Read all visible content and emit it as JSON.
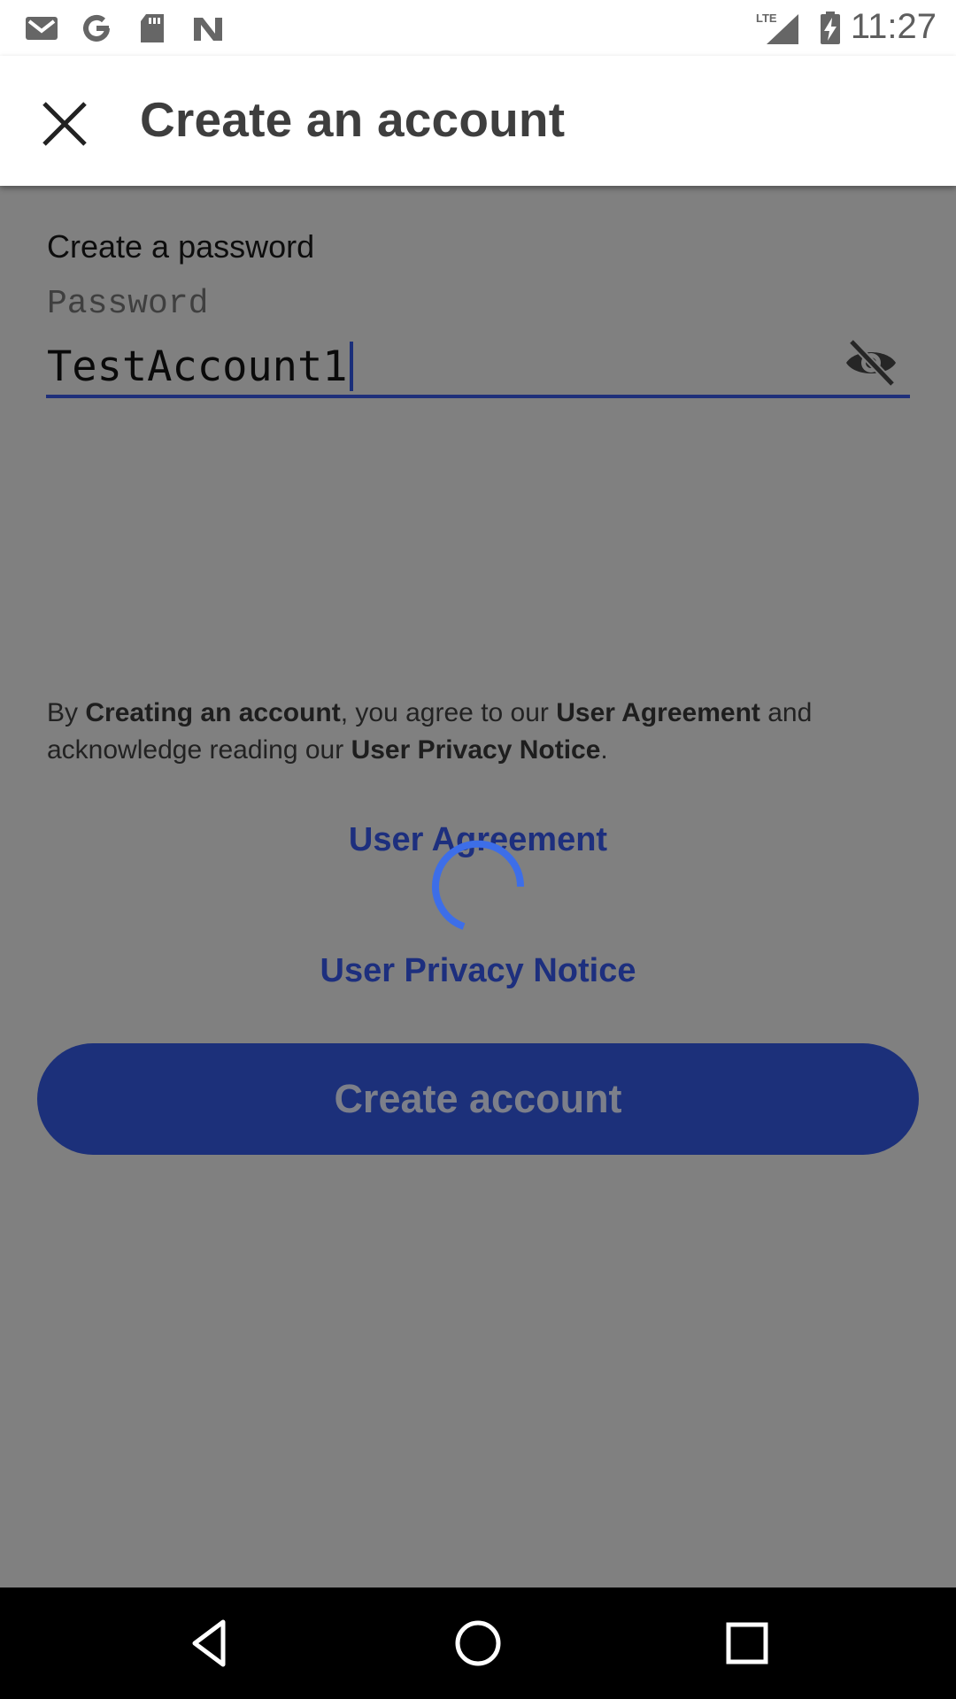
{
  "status_bar": {
    "time": "11:27",
    "left_icons": [
      "gmail-icon",
      "google-icon",
      "sd-card-icon",
      "nfc-icon"
    ],
    "right_icons": [
      "lte-signal-icon",
      "battery-charging-icon"
    ],
    "network_label": "LTE"
  },
  "app_bar": {
    "title": "Create an account",
    "close_icon": "close-icon"
  },
  "form": {
    "section_label": "Create a password",
    "password_label": "Password",
    "password_value": "TestAccount1",
    "visibility_icon": "visibility-off-icon"
  },
  "legal": {
    "prefix": "By ",
    "creating": "Creating an account",
    "mid1": ", you agree to our ",
    "agreement": "User Agreement",
    "mid2": " and acknowledge reading our ",
    "privacy": "User Privacy Notice",
    "suffix": "."
  },
  "links": {
    "user_agreement": "User Agreement",
    "user_privacy_notice": "User Privacy Notice"
  },
  "button": {
    "create_account": "Create account"
  },
  "colors": {
    "accent": "#1d307a",
    "spinner": "#3d6ee8",
    "scrim": "#808080"
  },
  "nav_bar": {
    "icons": [
      "back-icon",
      "home-icon",
      "recents-icon"
    ]
  }
}
